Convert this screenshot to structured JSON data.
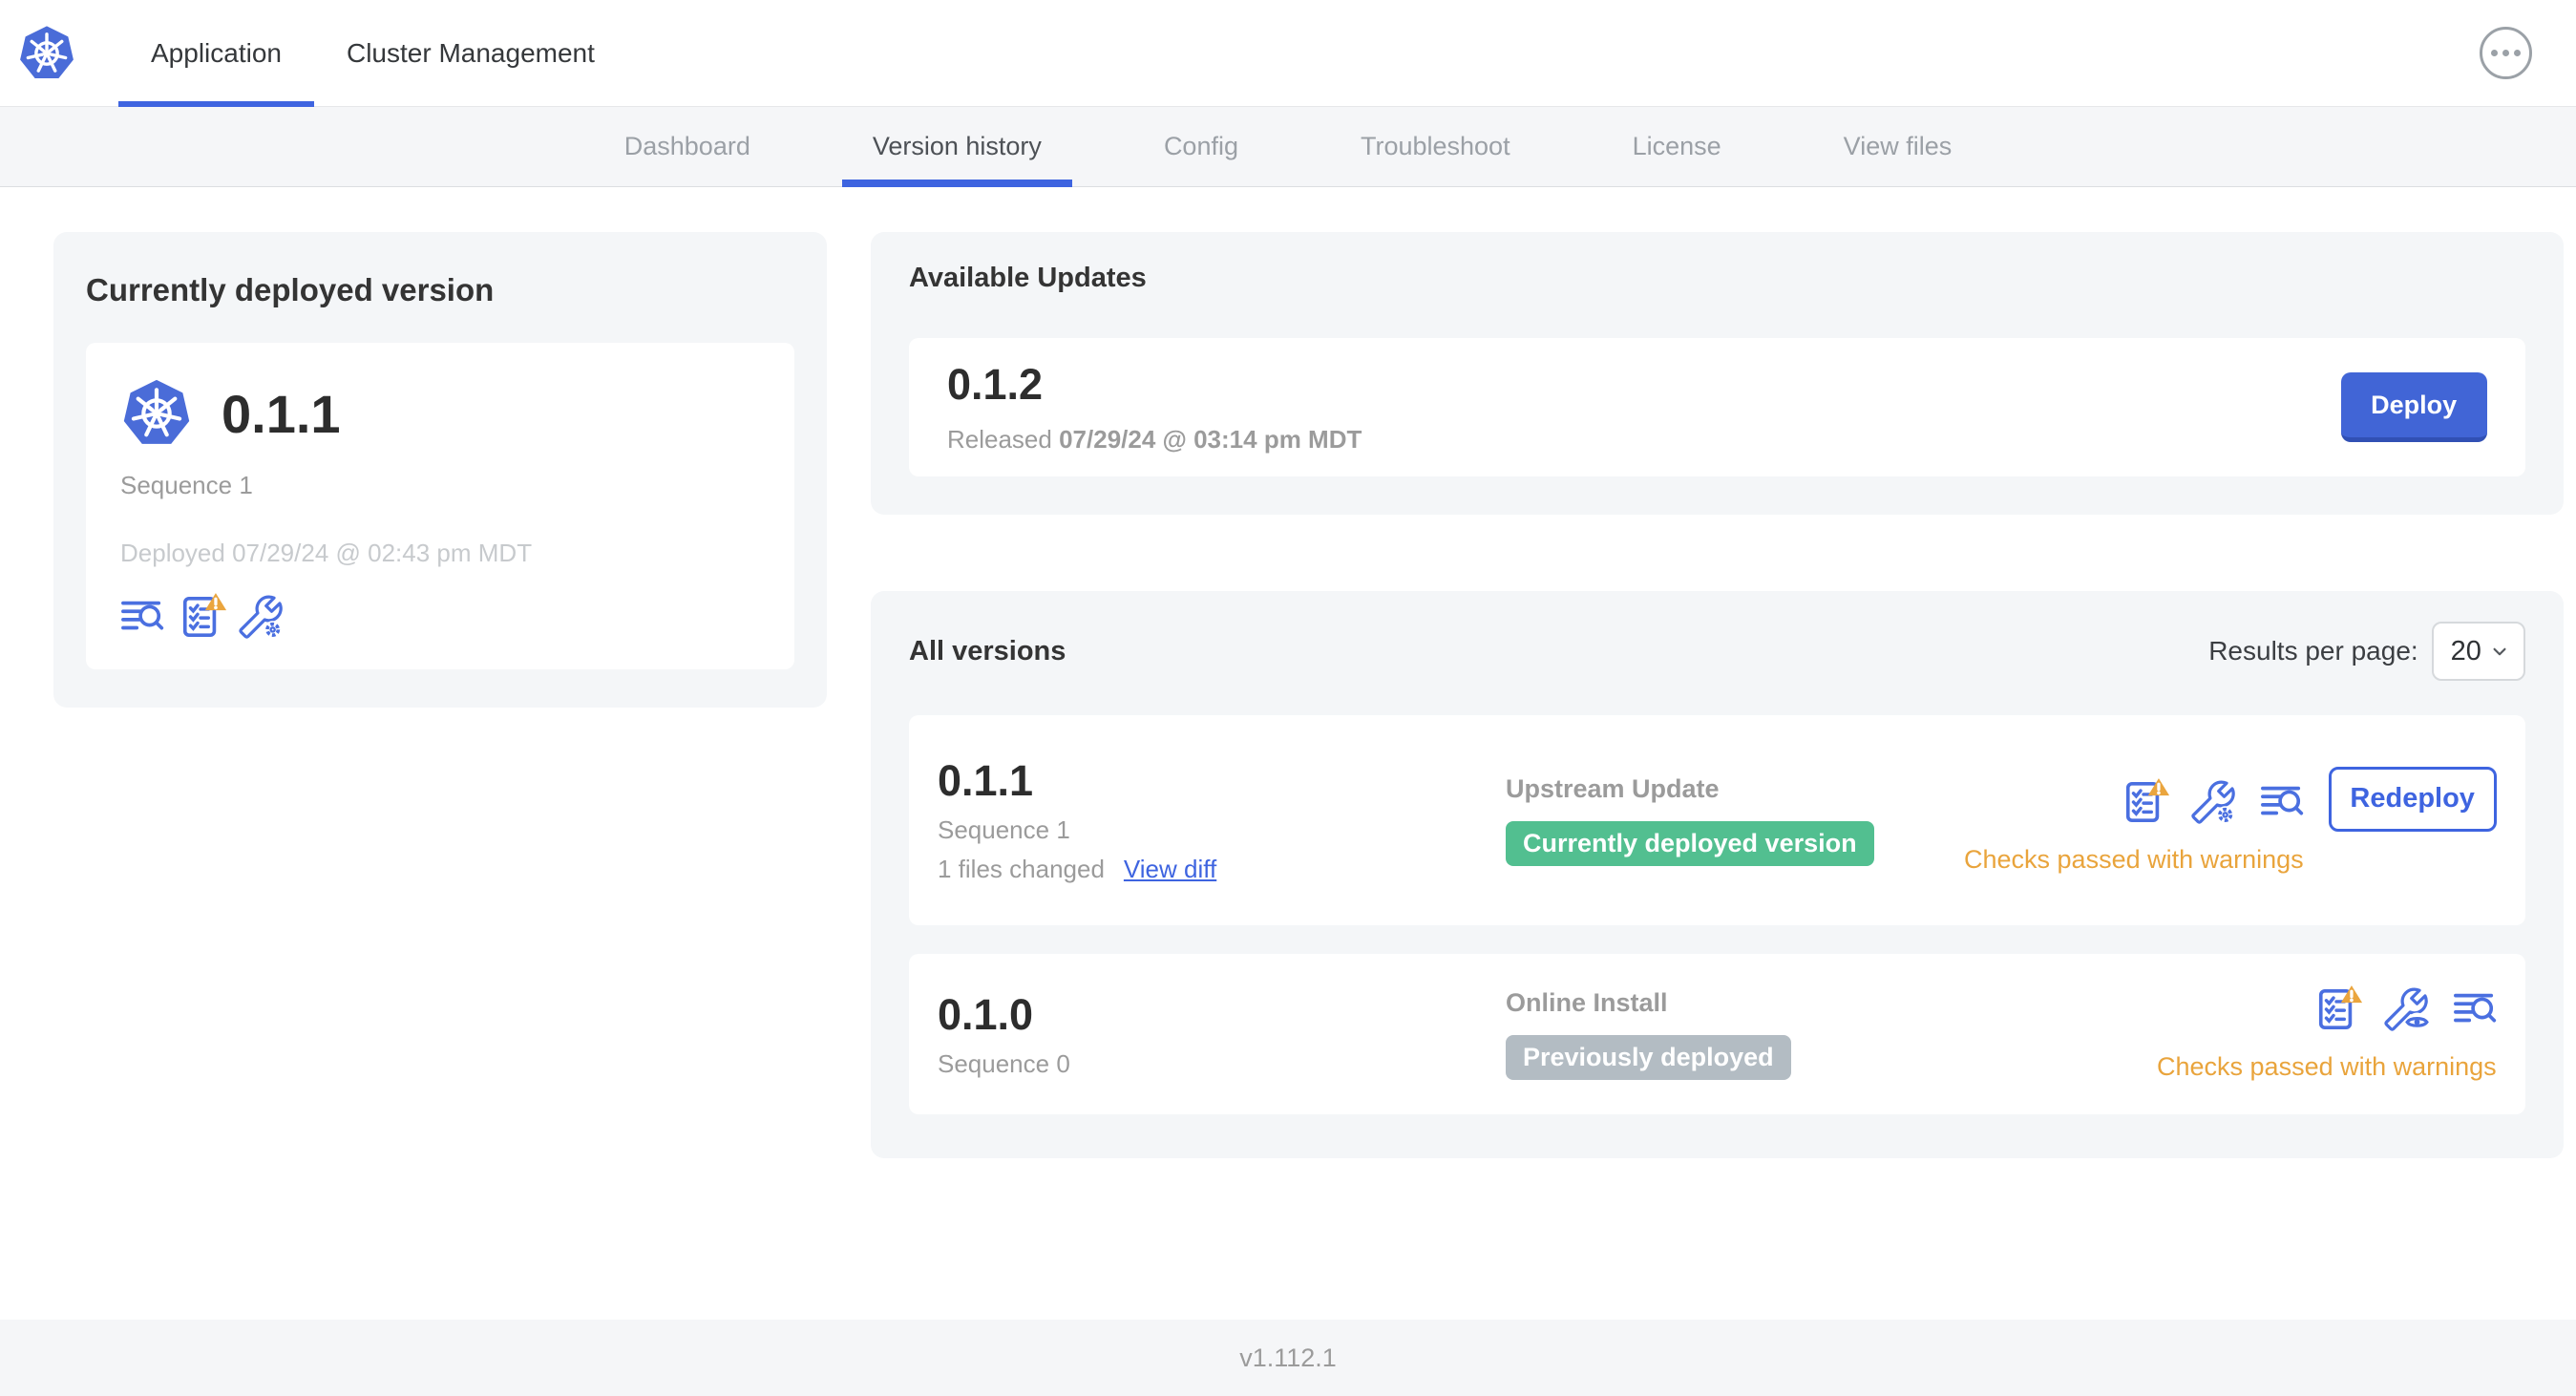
{
  "header": {
    "tabs": [
      {
        "label": "Application"
      },
      {
        "label": "Cluster Management"
      }
    ]
  },
  "subnav": {
    "tabs": [
      "Dashboard",
      "Version history",
      "Config",
      "Troubleshoot",
      "License",
      "View files"
    ],
    "active": "Version history"
  },
  "current_version": {
    "title": "Currently deployed version",
    "version": "0.1.1",
    "sequence": "Sequence 1",
    "deployed": "Deployed 07/29/24 @ 02:43 pm MDT"
  },
  "available_updates": {
    "title": "Available Updates",
    "version": "0.1.2",
    "released_label": "Released",
    "released_date": "07/29/24 @ 03:14 pm MDT",
    "deploy_button": "Deploy"
  },
  "all_versions": {
    "title": "All versions",
    "results_per_page_label": "Results per page:",
    "results_per_page": "20",
    "rows": [
      {
        "version": "0.1.1",
        "sequence": "Sequence 1",
        "files_changed": "1 files changed",
        "view_diff": "View diff",
        "source": "Upstream Update",
        "status_badge": "Currently deployed version",
        "badge_type": "green",
        "checks": "Checks passed with warnings",
        "action": "Redeploy"
      },
      {
        "version": "0.1.0",
        "sequence": "Sequence 0",
        "source": "Online Install",
        "status_badge": "Previously deployed",
        "badge_type": "gray",
        "checks": "Checks passed with warnings"
      }
    ]
  },
  "footer": {
    "version": "v1.112.1"
  },
  "icons": {
    "brand": "kubernetes-logo",
    "menu": "ellipsis-menu-icon",
    "logs": "deploy-logs-icon",
    "preflight": "preflight-checks-icon",
    "preflight_warning": "warning-triangle-icon",
    "edit_config": "edit-config-icon",
    "view_config": "view-config-icon",
    "select_caret": "chevron-down-icon"
  },
  "colors": {
    "accent_blue": "#3e64e0",
    "icon_blue": "#4a6fe0",
    "warning_orange": "#e9a43c",
    "green_badge": "#52bf90",
    "gray_badge": "#b3bcc3",
    "card_bg": "#f4f6f8",
    "k8s_blue": "#4a6cd8"
  }
}
